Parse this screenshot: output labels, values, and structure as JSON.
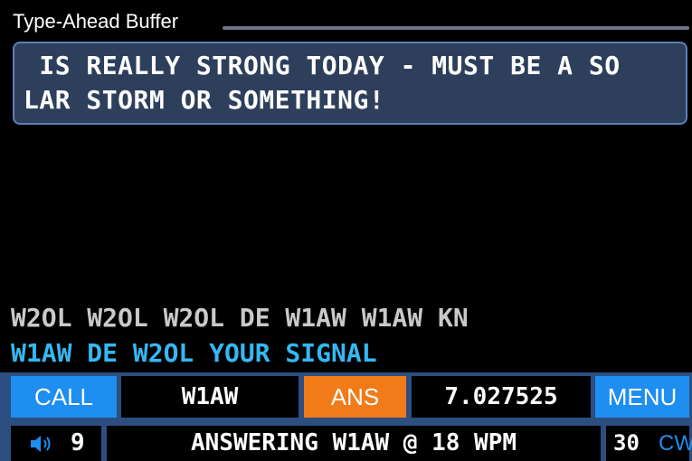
{
  "buffer": {
    "title": "Type-Ahead Buffer",
    "lines": [
      " IS REALLY STRONG TODAY - MUST BE A SO",
      "LAR STORM OR SOMETHING!"
    ]
  },
  "transcript": {
    "rx": "W2OL W2OL W2OL DE W1AW W1AW KN",
    "tx": "W1AW DE W2OL YOUR SIGNAL"
  },
  "buttons": {
    "call": "CALL",
    "callsign": "W1AW",
    "ans": "ANS",
    "frequency": "7.027525",
    "menu": "MENU"
  },
  "status": {
    "volume": "9",
    "message": "ANSWERING W1AW @ 18 WPM",
    "speed": "30",
    "mode": "CW"
  },
  "colors": {
    "accent_blue": "#1e8ef0",
    "ans_orange": "#f07b18",
    "tx_text": "#35b8f2",
    "bar_background": "#2d4e80",
    "buffer_background": "#2e3f5c"
  },
  "icons": {
    "volume": "speaker-icon"
  }
}
